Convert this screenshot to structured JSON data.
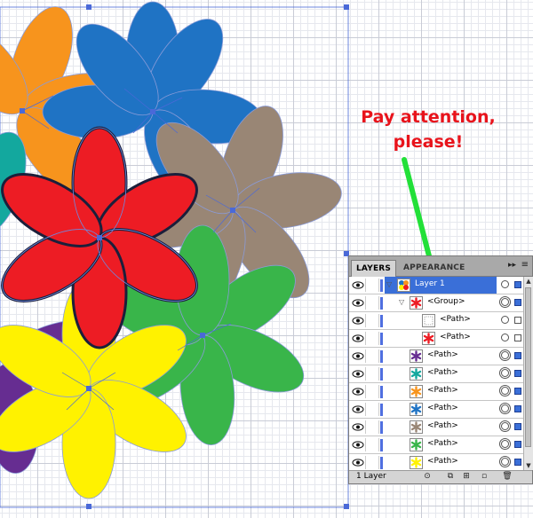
{
  "annotation": {
    "line1": "Pay attention,",
    "line2": "please!"
  },
  "colors": {
    "orange": "#f7941d",
    "blue": "#1f73c4",
    "taupe": "#998675",
    "teal": "#13a89e",
    "red": "#ed1c24",
    "green": "#39b54a",
    "yellow": "#fff200",
    "purple": "#662d91",
    "arrow": "#22e038",
    "selection": "#3a6fd8"
  },
  "layers_panel": {
    "tabs": {
      "layers": "LAYERS",
      "appearance": "APPEARANCE"
    },
    "menu_icon": "double-chevron-right-icon",
    "footer": {
      "count": "1 Layer"
    },
    "rows": [
      {
        "label": "Layer 1",
        "level": 0,
        "twirl": "open",
        "selected": true,
        "swatch": "multi",
        "target": "single",
        "selbox": "filled"
      },
      {
        "label": "<Group>",
        "level": 1,
        "twirl": "open",
        "selected": false,
        "swatch": "#ed1c24",
        "target": "double",
        "selbox": "filled"
      },
      {
        "label": "<Path>",
        "level": 2,
        "twirl": "none",
        "selected": false,
        "swatch": "none",
        "target": "single",
        "selbox": "empty"
      },
      {
        "label": "<Path>",
        "level": 2,
        "twirl": "none",
        "selected": false,
        "swatch": "#ed1c24",
        "target": "single",
        "selbox": "empty"
      },
      {
        "label": "<Path>",
        "level": 1,
        "twirl": "none",
        "selected": false,
        "swatch": "#662d91",
        "target": "double",
        "selbox": "filled"
      },
      {
        "label": "<Path>",
        "level": 1,
        "twirl": "none",
        "selected": false,
        "swatch": "#13a89e",
        "target": "double",
        "selbox": "filled"
      },
      {
        "label": "<Path>",
        "level": 1,
        "twirl": "none",
        "selected": false,
        "swatch": "#f7941d",
        "target": "double",
        "selbox": "filled"
      },
      {
        "label": "<Path>",
        "level": 1,
        "twirl": "none",
        "selected": false,
        "swatch": "#1f73c4",
        "target": "double",
        "selbox": "filled"
      },
      {
        "label": "<Path>",
        "level": 1,
        "twirl": "none",
        "selected": false,
        "swatch": "#998675",
        "target": "double",
        "selbox": "filled"
      },
      {
        "label": "<Path>",
        "level": 1,
        "twirl": "none",
        "selected": false,
        "swatch": "#39b54a",
        "target": "double",
        "selbox": "filled"
      },
      {
        "label": "<Path>",
        "level": 1,
        "twirl": "none",
        "selected": false,
        "swatch": "#fff200",
        "target": "double",
        "selbox": "filled"
      }
    ]
  }
}
